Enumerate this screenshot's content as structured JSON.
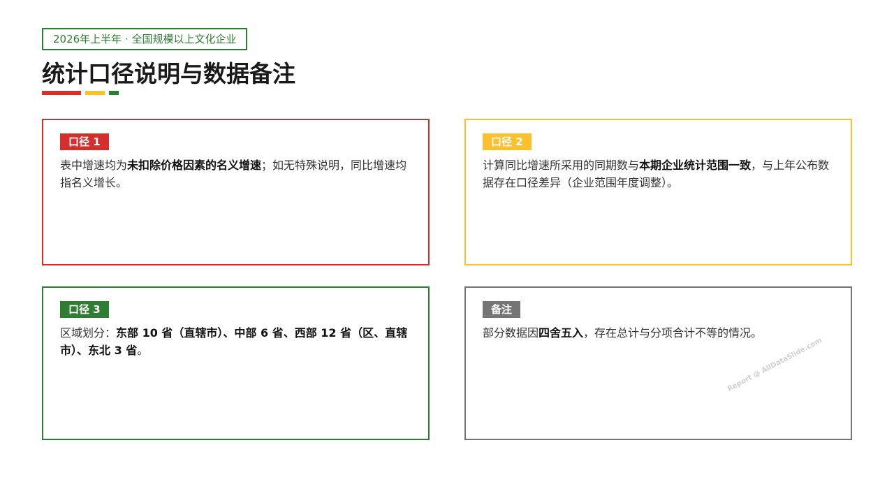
{
  "header": {
    "tag": "2026年上半年 · 全国规模以上文化企业",
    "title": "统计口径说明与数据备注"
  },
  "colors": {
    "red": "#d32f2f",
    "yellow": "#fbc02d",
    "green": "#2e7d32",
    "gray": "#757575"
  },
  "cards": [
    {
      "label": "口径 1",
      "segments": [
        {
          "text": "表中增速均为",
          "bold": false
        },
        {
          "text": "未扣除价格因素的名义增速",
          "bold": true
        },
        {
          "text": "；如无特殊说明，同比增速均指名义增长。",
          "bold": false
        }
      ]
    },
    {
      "label": "口径 2",
      "segments": [
        {
          "text": "计算同比增速所采用的同期数与",
          "bold": false
        },
        {
          "text": "本期企业统计范围一致",
          "bold": true
        },
        {
          "text": "，与上年公布数据存在口径差异（企业范围年度调整）。",
          "bold": false
        }
      ]
    },
    {
      "label": "口径 3",
      "segments": [
        {
          "text": "区域划分：",
          "bold": false
        },
        {
          "text": "东部 10 省（直辖市）、中部 6 省、西部 12 省（区、直辖市）、东北 3 省",
          "bold": true
        },
        {
          "text": "。",
          "bold": false
        }
      ]
    },
    {
      "label": "备注",
      "segments": [
        {
          "text": "部分数据因",
          "bold": false
        },
        {
          "text": "四舍五入",
          "bold": true
        },
        {
          "text": "，存在总计与分项合计不等的情况。",
          "bold": false
        }
      ]
    }
  ],
  "watermark": "Report @ AllDataSlide.com"
}
